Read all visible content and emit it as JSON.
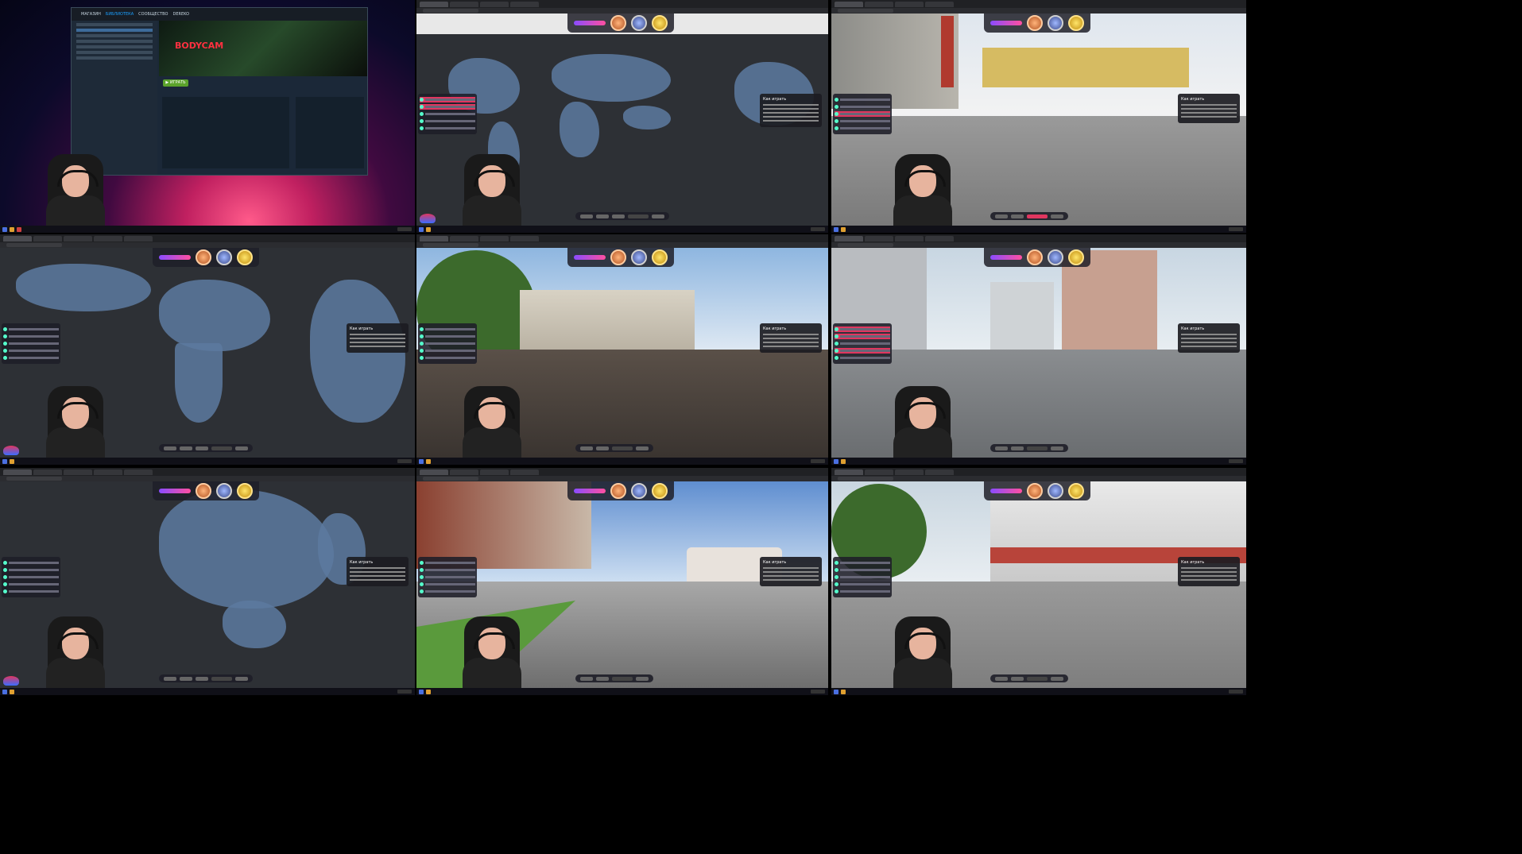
{
  "steam": {
    "menu": [
      "МАГАЗИН",
      "БИБЛИОТЕКА",
      "СООБЩЕСТВО",
      "DEREKO"
    ],
    "game_logo": "BODYCAM",
    "play_label": "▶ ИГРАТЬ"
  },
  "game": {
    "help_title": "Как играть",
    "help_panel_title": "Как играть"
  },
  "map_labels": {
    "brand": "MapMint"
  },
  "colors": {
    "accent_pink": "#e0365f",
    "accent_purple": "#8a4cff",
    "map_land": "#5d7aa0",
    "map_sea": "#2d3035",
    "steam_bg": "#1b2838",
    "play_green": "#5ba32b"
  },
  "icons": [
    "start-icon",
    "browser-icon",
    "medal-bronze-icon",
    "medal-silver-icon",
    "medal-gold-icon",
    "gear-icon"
  ]
}
